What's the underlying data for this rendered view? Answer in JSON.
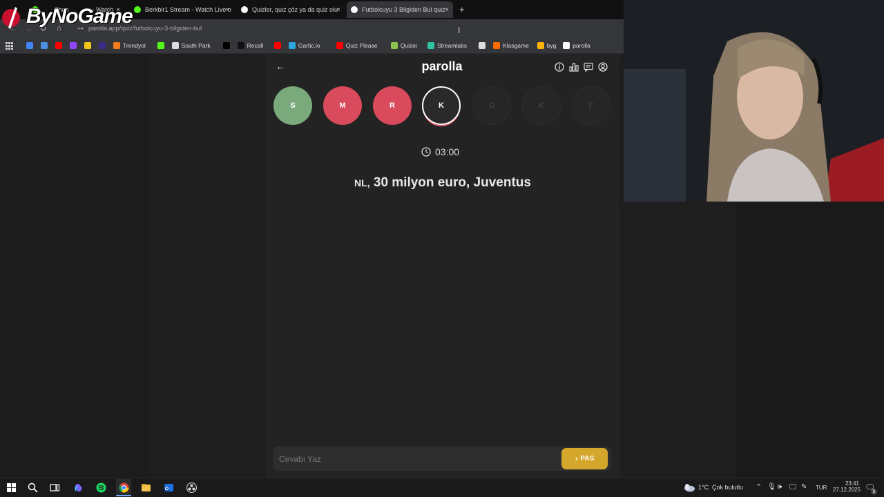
{
  "browser": {
    "tabs": [
      {
        "label": "Chan",
        "suffix": "- Watch",
        "fav_color": "#53fc18",
        "active": false
      },
      {
        "label": "Berkbir1 Stream - Watch Live o",
        "fav_color": "#53fc18",
        "active": false
      },
      {
        "label": "Quizler, quiz çöz ya da quiz olu",
        "fav_color": "#ffffff",
        "active": false
      },
      {
        "label": "Futbolcuyu 3 Bilgiden Bul quiz",
        "fav_color": "#ffffff",
        "active": true
      }
    ],
    "tab_close": "×",
    "new_tab": "+",
    "url": "parolla.app/quiz/futbolcuyu-3-bilgiden-bul",
    "bookmarks": [
      {
        "label": "",
        "color": "#4285f4"
      },
      {
        "label": "",
        "color": "#4a90e2"
      },
      {
        "label": "",
        "color": "#ff0000"
      },
      {
        "label": "",
        "color": "#9146ff"
      },
      {
        "label": "",
        "color": "#f5c518"
      },
      {
        "label": "",
        "color": "#3b2a8a"
      },
      {
        "label": "Trendyol",
        "color": "#f27a1a"
      },
      {
        "label": "",
        "color": "#53fc18"
      },
      {
        "label": "South Park",
        "color": "#dddddd"
      },
      {
        "label": "",
        "color": "#000000"
      },
      {
        "label": "Recall",
        "color": "#111111"
      },
      {
        "label": "",
        "color": "#ff0000"
      },
      {
        "label": "Gartic.io",
        "color": "#2aa7e0"
      },
      {
        "label": "Quiz Please",
        "color": "#ff0000"
      },
      {
        "label": "Quizei",
        "color": "#8bc34a"
      },
      {
        "label": "Streamlabs",
        "color": "#31c3a2"
      },
      {
        "label": "",
        "color": "#dddddd"
      },
      {
        "label": "Klasgame",
        "color": "#ff6a00"
      },
      {
        "label": "byg",
        "color": "#ffb300"
      },
      {
        "label": "parolla",
        "color": "#ffffff"
      }
    ]
  },
  "overlay": {
    "logo_text": "ByNoGame"
  },
  "app": {
    "back_icon": "back-arrow-icon",
    "brand": "parolla",
    "header_icons": [
      "info-icon",
      "stats-icon",
      "chat-icon",
      "profile-icon"
    ],
    "letters": [
      {
        "letter": "S",
        "state": "correct",
        "color": "#7aaa7c"
      },
      {
        "letter": "M",
        "state": "wrong",
        "color": "#d94a5c"
      },
      {
        "letter": "R",
        "state": "wrong",
        "color": "#d94a5c"
      },
      {
        "letter": "K",
        "state": "current",
        "color": "#2a2a2a"
      },
      {
        "letter": "G",
        "state": "pending",
        "color": "#262626"
      },
      {
        "letter": "K",
        "state": "pending",
        "color": "#262626"
      },
      {
        "letter": "F",
        "state": "pending",
        "color": "#262626"
      }
    ],
    "timer": "03:00",
    "question_prefix": "NL,",
    "question_main": "30 milyon euro, Juventus",
    "answer_placeholder": "Cevabı Yaz",
    "pass_label": "PAS",
    "accent": "#d4a72c"
  },
  "taskbar": {
    "weather_temp": "1°C",
    "weather_text": "Çok bulutlu",
    "lang": "TUR",
    "time": "23:41",
    "date": "27.12.2025",
    "notif_count": "5"
  }
}
